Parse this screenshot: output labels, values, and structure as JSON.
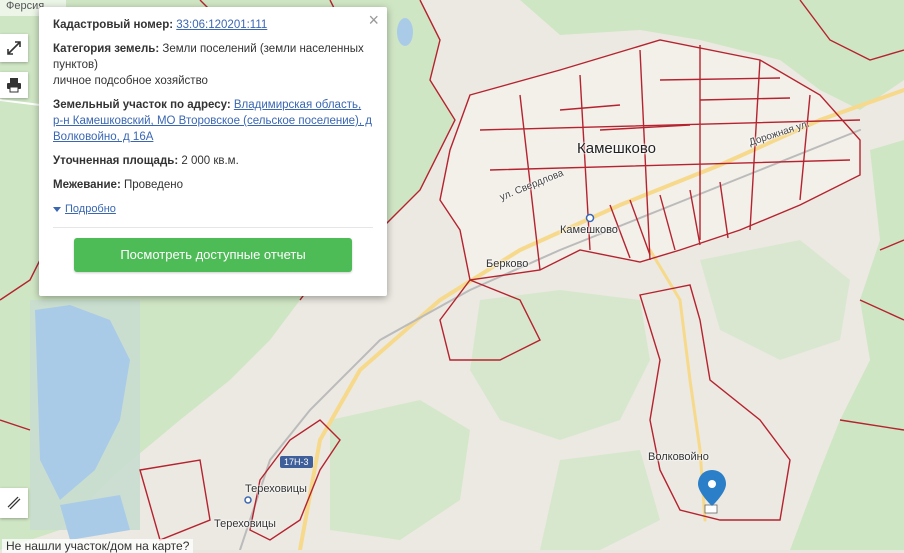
{
  "map": {
    "city_label": "Камешково",
    "station_label": "Камешково",
    "village_berkovo": "Берково",
    "village_volkovoino": "Волковойно",
    "village_terekhovitsy_1": "Тереховицы",
    "village_terekhovitsy_2": "Тереховицы",
    "street_sverdlova": "ул. Свердлова",
    "street_dorozhnaya": "Дорожная ул.",
    "road_badge": "17Н-3"
  },
  "top_strip": {
    "text": "Ферсия"
  },
  "controls": {
    "expand_icon": "expand-icon",
    "print_icon": "print-icon",
    "ruler_icon": "ruler-icon"
  },
  "popup": {
    "cadastral_label": "Кадастровый номер:",
    "cadastral_value": "33:06:120201:111",
    "category_label": "Категория земель:",
    "category_value": "Земли поселений (земли населенных пунктов)",
    "usage_value": "личное подсобное хозяйство",
    "address_label": "Земельный участок по адресу:",
    "address_value": "Владимирская область, р-н Камешковский, МО Второвское (сельское поселение), д Волковойно, д 16А",
    "area_label": "Уточненная площадь:",
    "area_value": "2 000 кв.м.",
    "survey_label": "Межевание:",
    "survey_value": "Проведено",
    "more_label": "Подробно",
    "button_label": "Посмотреть доступные отчеты",
    "close_symbol": "×"
  },
  "bottom_text": "Не нашли участок/дом на карте?",
  "colors": {
    "button": "#4dbb56",
    "link": "#3a67b3",
    "boundary": "#b5232f",
    "forest": "#cfe6c4",
    "marker": "#2b7fc9"
  }
}
